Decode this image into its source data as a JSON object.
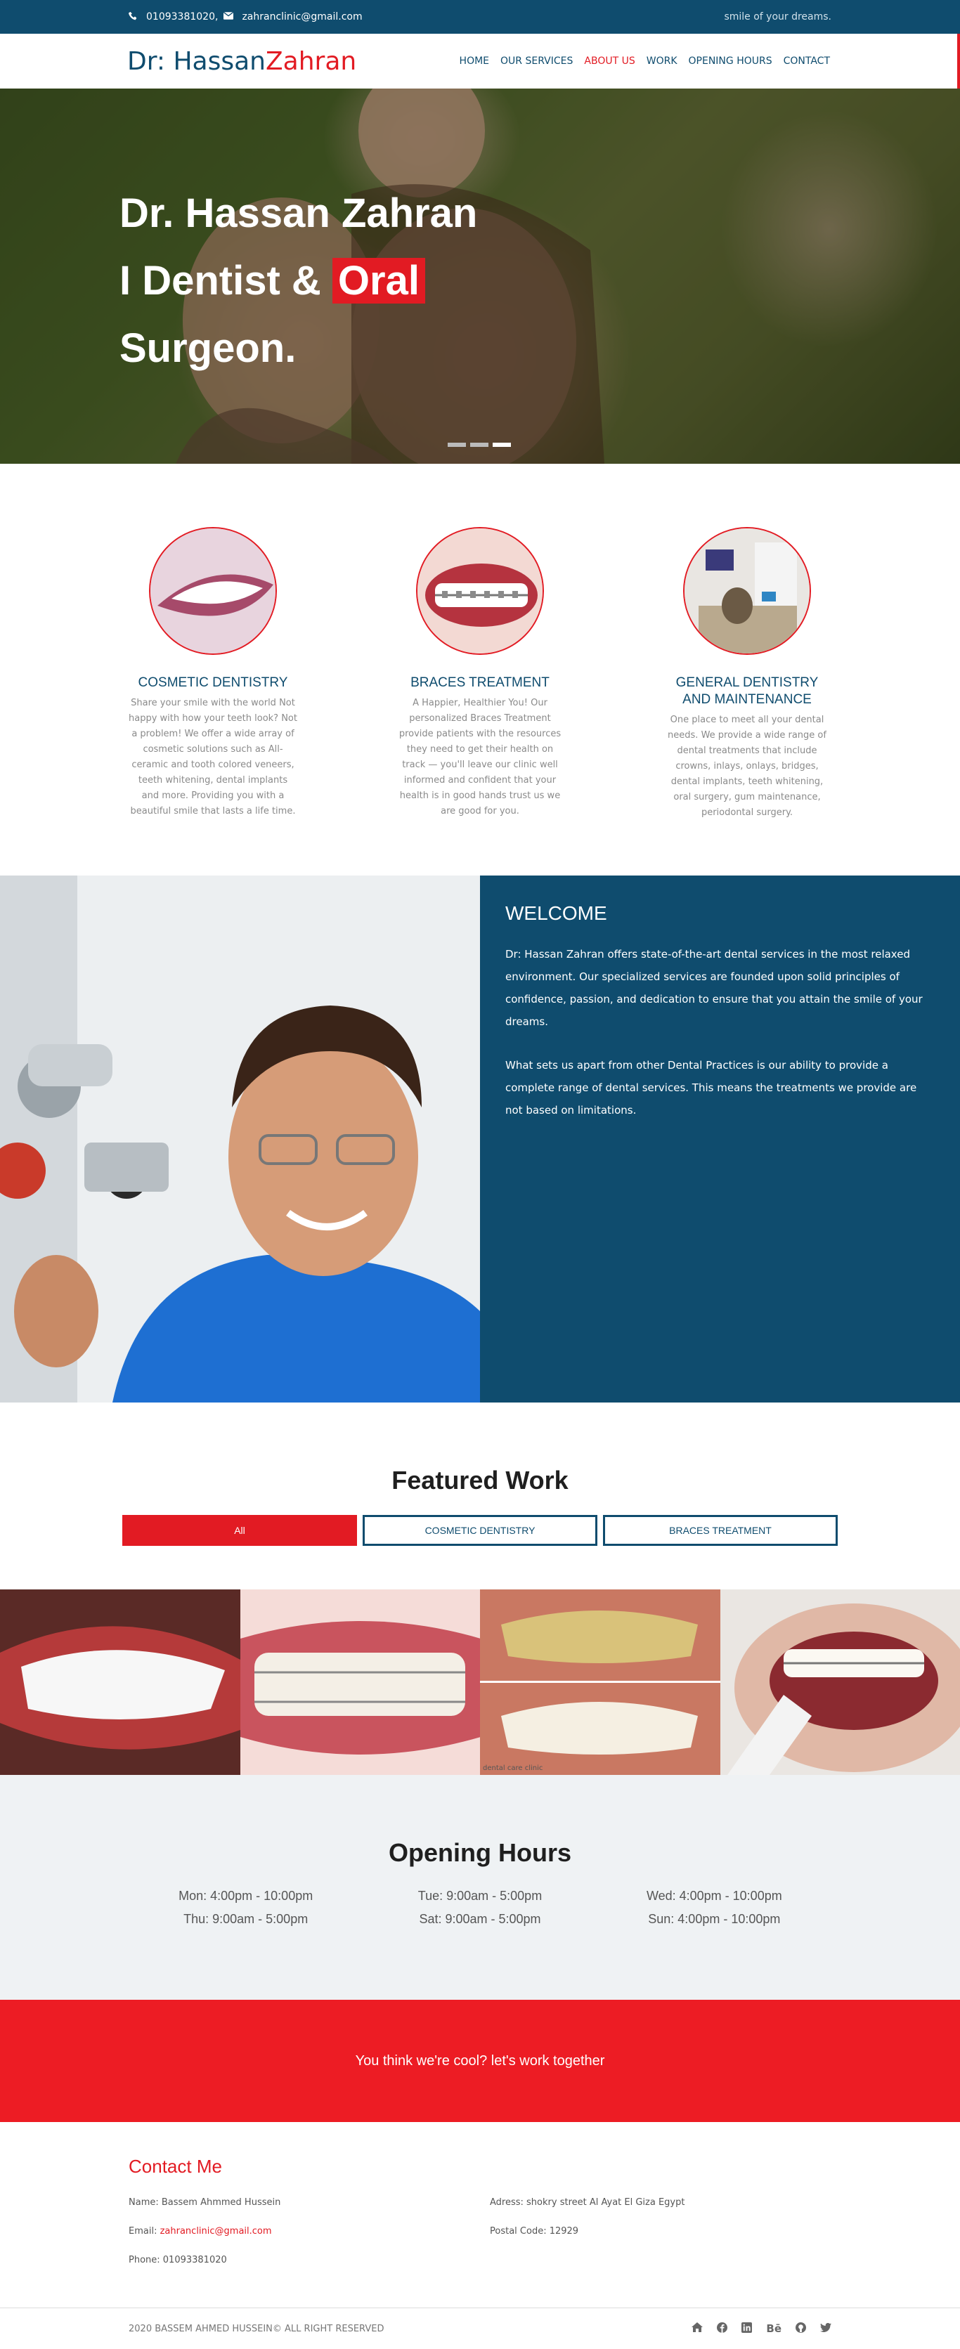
{
  "topbar": {
    "phone": "01093381020,",
    "email": "zahranclinic@gmail.com",
    "tagline": "smile of your dreams."
  },
  "header": {
    "logo_part1": "Dr: Hassan",
    "logo_part2": "Zahran",
    "nav": [
      "HOME",
      "OUR SERVICES",
      "ABOUT US",
      "WORK",
      "OPENING HOURS",
      "CONTACT"
    ],
    "active_nav": "ABOUT US"
  },
  "hero": {
    "line1": "Dr. Hassan Zahran",
    "line2_start": "I Dentist & ",
    "line2_highlight": "Oral",
    "line3": "Surgeon.",
    "slide_count": 3,
    "active_slide": 3
  },
  "services": [
    {
      "title": "COSMETIC DENTISTRY",
      "text": "Share your smile with the world Not happy with how your teeth look? Not a problem! We offer a wide array of cosmetic solutions such as All-ceramic and tooth colored veneers, teeth whitening, dental implants and more. Providing you with a beautiful smile that lasts a life time."
    },
    {
      "title": "BRACES TREATMENT",
      "text": "A Happier, Healthier You! Our personalized Braces Treatment provide patients with the resources they need to get their health on track — you'll leave our clinic well informed and confident that your health is in good hands trust us we are good for you."
    },
    {
      "title": "GENERAL DENTISTRY AND MAINTENANCE",
      "text": "One place to meet all your dental needs. We provide a wide range of dental treatments that include crowns, inlays, onlays, bridges, dental implants, teeth whitening, oral surgery, gum maintenance, periodontal surgery."
    }
  ],
  "welcome": {
    "title": "WELCOME",
    "p1": "Dr: Hassan Zahran offers state-of-the-art dental services in the most relaxed environment. Our specialized services are founded upon solid principles of confidence, passion, and dedication to ensure that you attain the smile of your dreams.",
    "p2": "What sets us apart from other Dental Practices is our ability to provide a complete range of dental services. This means the treatments we provide are not based on limitations."
  },
  "featured": {
    "title": "Featured Work",
    "filters": [
      "All",
      "COSMETIC DENTISTRY",
      "BRACES TREATMENT"
    ],
    "active_filter": "All",
    "gallery_caption": "dental care clinic"
  },
  "hours": {
    "title": "Opening Hours",
    "items": [
      "Mon: 4:00pm - 10:00pm",
      "Tue: 9:00am - 5:00pm",
      "Wed: 4:00pm - 10:00pm",
      "Thu: 9:00am - 5:00pm",
      "Sat: 9:00am - 5:00pm",
      "Sun: 4:00pm - 10:00pm"
    ]
  },
  "cta": {
    "text": "You think we're cool? let's work together"
  },
  "contact": {
    "title": "Contact Me",
    "name": "Name: Bassem Ahmmed Hussein",
    "address": "Adress: shokry street Al Ayat El Giza Egypt",
    "email_label": "Email: ",
    "email": "zahranclinic@gmail.com",
    "postal": "Postal Code: 12929",
    "phone": "Phone: 01093381020"
  },
  "footer": {
    "copyright": "2020 BASSEM AHMED HUSSEIN© ALL RIGHT RESERVED",
    "behance_glyph": "Bē",
    "social": [
      "home-icon",
      "facebook-icon",
      "linkedin-icon",
      "behance-icon",
      "github-icon",
      "twitter-icon"
    ]
  },
  "colors": {
    "primary": "#0f4c6e",
    "accent": "#e21b23",
    "light_bg": "#eff2f4"
  }
}
